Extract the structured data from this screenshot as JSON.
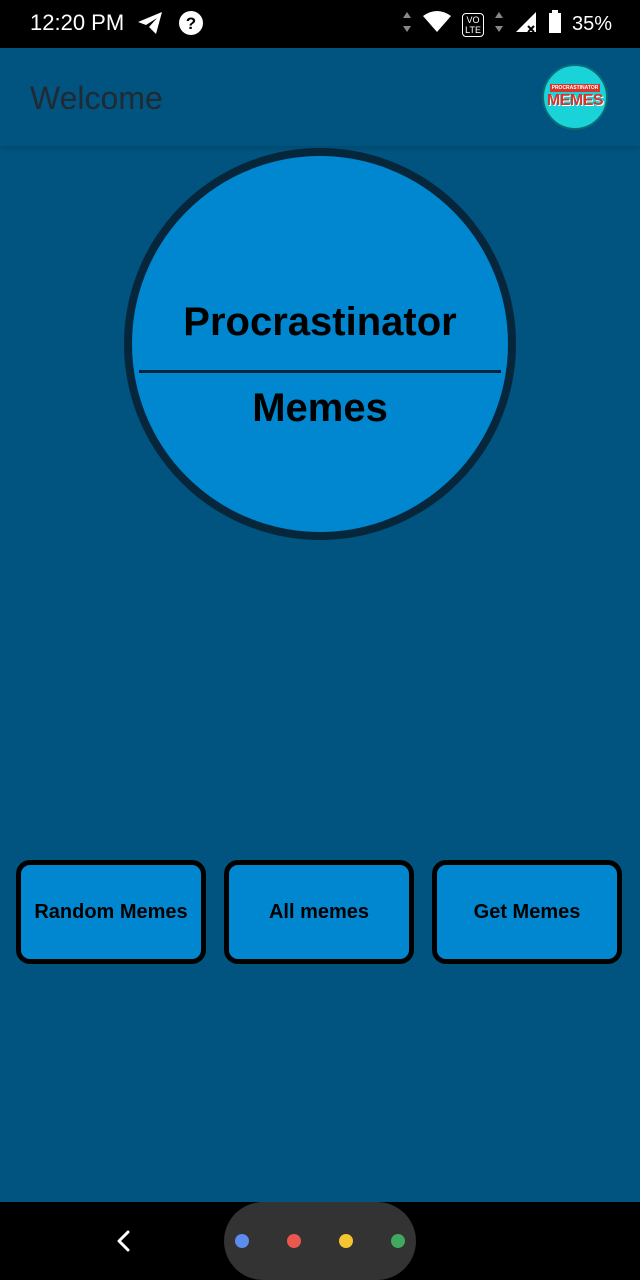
{
  "status_bar": {
    "time": "12:20 PM",
    "lte_top": "VO",
    "lte_bottom": "LTE",
    "battery_percent": "35%",
    "icons": [
      "telegram-icon",
      "help-icon",
      "data-arrows-icon",
      "wifi-icon",
      "volte-icon",
      "signal-icon",
      "battery-icon"
    ]
  },
  "app_bar": {
    "title": "Welcome",
    "logo_top": "PROCRASTINATOR",
    "logo_main": "MEMES"
  },
  "hero": {
    "line1": "Procrastinator",
    "line2": "Memes"
  },
  "buttons": {
    "random": "Random Memes",
    "all": "All memes",
    "get": "Get Memes"
  },
  "nav": {
    "assistant_dot_colors": [
      "#5b8def",
      "#e8584f",
      "#f5c431",
      "#3fa95f"
    ]
  },
  "colors": {
    "background": "#00547f",
    "accent": "#0087cf",
    "border": "#06263b"
  }
}
